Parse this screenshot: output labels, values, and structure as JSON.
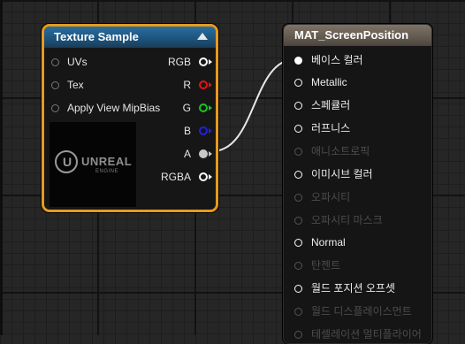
{
  "texture_node": {
    "title": "Texture Sample",
    "inputs": [
      {
        "label": "UVs"
      },
      {
        "label": "Tex"
      },
      {
        "label": "Apply View MipBias"
      }
    ],
    "outputs": [
      {
        "label": "RGB",
        "color": "#ffffff"
      },
      {
        "label": "R",
        "color": "#e01515"
      },
      {
        "label": "G",
        "color": "#1ec41e"
      },
      {
        "label": "B",
        "color": "#2222dd"
      },
      {
        "label": "A",
        "color": "#c8c8c8"
      },
      {
        "label": "RGBA",
        "color": "#ffffff"
      }
    ],
    "thumbnail": {
      "logo_text": "UNREAL",
      "logo_sub": "ENGINE"
    },
    "border_color": "#e69a1c"
  },
  "material_node": {
    "title": "MAT_ScreenPosition",
    "pins": [
      {
        "label": "베이스 컬러",
        "enabled": true,
        "connected": true
      },
      {
        "label": "Metallic",
        "enabled": true,
        "connected": false
      },
      {
        "label": "스페큘러",
        "enabled": true,
        "connected": false
      },
      {
        "label": "러프니스",
        "enabled": true,
        "connected": false
      },
      {
        "label": "애니소트로픽",
        "enabled": false,
        "connected": false
      },
      {
        "label": "이미시브 컬러",
        "enabled": true,
        "connected": false
      },
      {
        "label": "오파시티",
        "enabled": false,
        "connected": false
      },
      {
        "label": "오파시티 마스크",
        "enabled": false,
        "connected": false
      },
      {
        "label": "Normal",
        "enabled": true,
        "connected": false
      },
      {
        "label": "탄젠트",
        "enabled": false,
        "connected": false
      },
      {
        "label": "월드 포지션 오프셋",
        "enabled": true,
        "connected": false
      },
      {
        "label": "월드 디스플레이스먼트",
        "enabled": false,
        "connected": false
      },
      {
        "label": "테셀레이션 멀티플라이어",
        "enabled": false,
        "connected": false
      }
    ]
  },
  "connection": {
    "from": "texture_node.A",
    "to": "material_node.베이스 컬러",
    "color": "#e8e8e8"
  }
}
